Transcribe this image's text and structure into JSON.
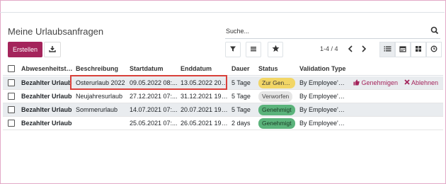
{
  "page": {
    "title": "Meine Urlaubsanfragen"
  },
  "search": {
    "placeholder": "Suche..."
  },
  "toolbar": {
    "create_label": "Erstellen"
  },
  "pager": {
    "text": "1-4 / 4"
  },
  "table": {
    "columns": [
      "Abwesenheitsty...",
      "Beschreibung",
      "Startdatum",
      "Enddatum",
      "Dauer",
      "Status",
      "Validation Type"
    ],
    "rows": [
      {
        "type": "Bezahlter Urlaub",
        "desc": "Osterurlaub 2022",
        "start": "09.05.2022 08:...",
        "end": "13.05.2022 20:...",
        "duration": "5 Tage",
        "status": "Zur Gene...",
        "validation": "By Employee's ...",
        "approve": "Genehmigen",
        "reject": "Ablehnen"
      },
      {
        "type": "Bezahlter Urlaub",
        "desc": "Neujahresurlaub",
        "start": "27.12.2021 07:...",
        "end": "31.12.2021 19:...",
        "duration": "5 Tage",
        "status": "Verworfen",
        "validation": "By Employee's ..."
      },
      {
        "type": "Bezahlter Urlaub",
        "desc": "Sommerurlaub",
        "start": "14.07.2021 07:...",
        "end": "20.07.2021 19:...",
        "duration": "5 Tage",
        "status": "Genehmigt",
        "validation": "By Employee's ..."
      },
      {
        "type": "Bezahlter Urlaub",
        "desc": "",
        "start": "25.05.2021 07:...",
        "end": "26.05.2021 19:...",
        "duration": "2 days",
        "status": "Genehmigt",
        "validation": "By Employee's ..."
      }
    ]
  },
  "colors": {
    "brand": "#a4245b",
    "highlight": "#d9403a",
    "pending": "#f2d666",
    "approved": "#5bb37b",
    "refused": "#e6e6e6"
  }
}
